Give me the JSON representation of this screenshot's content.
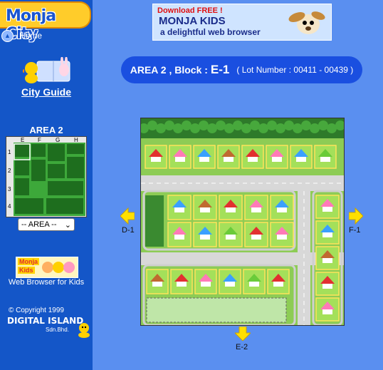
{
  "sidebar": {
    "logo_text": "Monja City",
    "home_label": "Home",
    "city_guide_label": "City Guide",
    "area_title": "AREA 2",
    "minimap": {
      "cols": [
        "E",
        "F",
        "G",
        "H"
      ],
      "rows": [
        "1",
        "2",
        "3",
        "4"
      ]
    },
    "area_select_value": "-- AREA --",
    "monja_kids_badge_line1": "Monja",
    "monja_kids_badge_line2": "Kids",
    "web_browser_label": "Web Browser for Kids",
    "copyright": "© Copyright 1999",
    "company": "DIGITAL ISLAND",
    "company_sub": "Sdn.Bhd."
  },
  "banner": {
    "download": "Download FREE !",
    "title": "MONJA KIDS",
    "subtitle": "a delightful web browser"
  },
  "block_info": {
    "prefix": "AREA 2 , Block :",
    "block": "E-1",
    "lot": "( Lot Number : 00411 - 00439 )"
  },
  "navigation": {
    "west": "D-1",
    "east": "F-1",
    "south": "E-2"
  },
  "colors": {
    "background": "#5a8ff0",
    "sidebar": "#1456c8",
    "pill": "#1a4fe0",
    "arrow": "#ffe000"
  }
}
